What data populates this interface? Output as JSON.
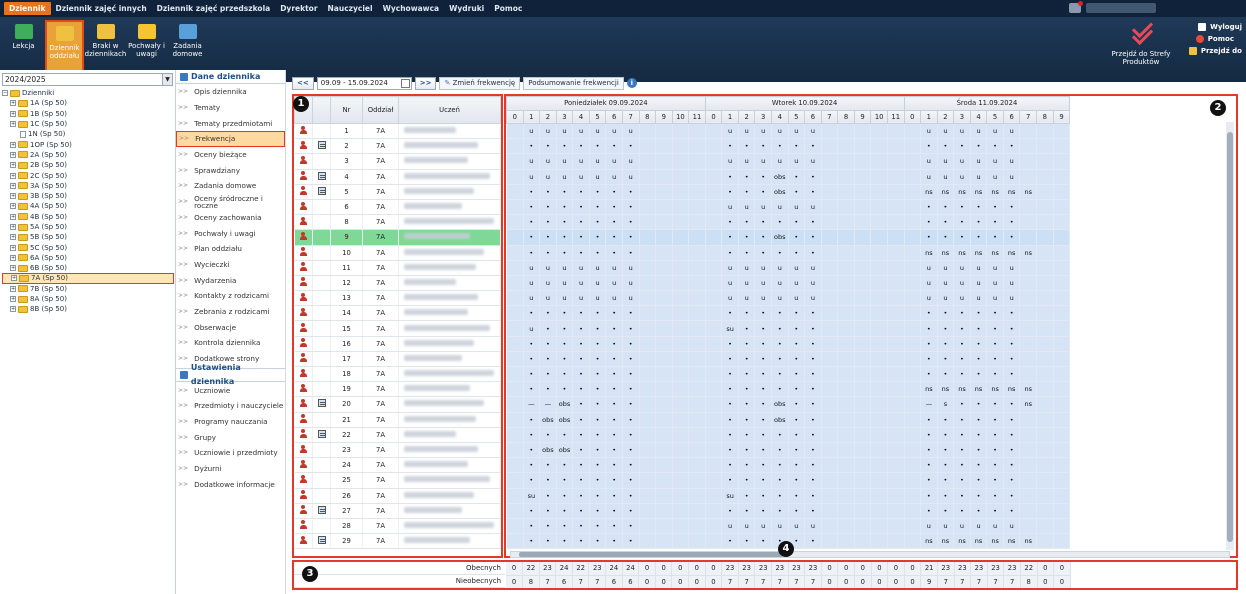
{
  "menu": [
    "Dziennik",
    "Dziennik zajęć innych",
    "Dziennik zajęć przedszkola",
    "Dyrektor",
    "Nauczyciel",
    "Wychowawca",
    "Wydruki",
    "Pomoc"
  ],
  "toolbar": [
    {
      "label": "Lekcja",
      "icon": "lesson-icon",
      "color": "#3fae5b",
      "active": false
    },
    {
      "label": "Dziennik oddziału",
      "icon": "class-journal-icon",
      "color": "#f0c040",
      "active": true
    },
    {
      "label": "Braki w dziennikach",
      "icon": "missing-entries-icon",
      "color": "#f0c040",
      "active": false
    },
    {
      "label": "Pochwały i uwagi",
      "icon": "remarks-icon",
      "color": "#f5c430",
      "active": false
    },
    {
      "label": "Zadania domowe",
      "icon": "homework-icon",
      "color": "#5aa0d8",
      "active": false
    }
  ],
  "right": {
    "strefa": "Przejdź do Strefy Produktów",
    "logout": "Wyloguj",
    "help": "Pomoc",
    "goto": "Przejdź do"
  },
  "year": "2024/2025",
  "tree": {
    "root": "Dzienniki",
    "items": [
      "1A (Sp 50)",
      "1B (Sp 50)",
      "1C (Sp 50)",
      "1N (Sp 50)",
      "1OP (Sp 50)",
      "2A (Sp 50)",
      "2B (Sp 50)",
      "2C (Sp 50)",
      "3A (Sp 50)",
      "3B (Sp 50)",
      "4A (Sp 50)",
      "4B (Sp 50)",
      "5A (Sp 50)",
      "5B (Sp 50)",
      "5C (Sp 50)",
      "6A (Sp 50)",
      "6B (Sp 50)",
      "7A (Sp 50)",
      "7B (Sp 50)",
      "8A (Sp 50)",
      "8B (Sp 50)"
    ],
    "selected": "7A (Sp 50)"
  },
  "nav": {
    "section1": "Dane dziennika",
    "items1": [
      "Opis dziennika",
      "Tematy",
      "Tematy przedmiotami",
      "Frekwencja",
      "Oceny bieżące",
      "Sprawdziany",
      "Zadania domowe",
      "Oceny śródroczne i roczne",
      "Oceny zachowania",
      "Pochwały i uwagi",
      "Plan oddziału",
      "Wycieczki",
      "Wydarzenia",
      "Kontakty z rodzicami",
      "Zebrania z rodzicami",
      "Obserwacje",
      "Kontrola dziennika",
      "Dodatkowe strony"
    ],
    "active": "Frekwencja",
    "section2": "Ustawienia dziennika",
    "items2": [
      "Uczniowie",
      "Przedmioty i nauczyciele",
      "Programy nauczania",
      "Grupy",
      "Uczniowie i przedmioty",
      "Dyżurni",
      "Dodatkowe informacje"
    ]
  },
  "controls": {
    "prev": "<<",
    "range": "09.09 - 15.09.2024",
    "next": ">>",
    "change": "Zmień frekwencję",
    "summary": "Podsumowanie frekwencji"
  },
  "table_headers": {
    "nr": "Nr",
    "class": "Oddział",
    "student": "Uczeń"
  },
  "days": [
    "Poniedziałek 09.09.2024",
    "Wtorek 10.09.2024",
    "Środa 11.09.2024"
  ],
  "lessons": [
    "0",
    "1",
    "2",
    "3",
    "4",
    "5",
    "6",
    "7",
    "8",
    "9",
    "10",
    "11"
  ],
  "students": [
    {
      "nr": "1",
      "cls": "7A",
      "note": false,
      "a": [
        "",
        "u",
        "u",
        "u",
        "u",
        "u",
        "u",
        "u",
        "",
        "",
        "",
        "",
        "",
        "u",
        "u",
        "u",
        "u",
        "u",
        "u",
        "",
        "",
        "",
        "",
        "",
        "",
        "u",
        "u",
        "u",
        "u",
        "u",
        "u",
        "",
        "",
        ""
      ]
    },
    {
      "nr": "2",
      "cls": "7A",
      "note": true,
      "a": [
        "",
        "•",
        "•",
        "•",
        "•",
        "•",
        "•",
        "•",
        "",
        "",
        "",
        "",
        "",
        "•",
        "•",
        "•",
        "•",
        "•",
        "•",
        "",
        "",
        "",
        "",
        "",
        "",
        "•",
        "•",
        "•",
        "•",
        "•",
        "•",
        "",
        "",
        ""
      ]
    },
    {
      "nr": "3",
      "cls": "7A",
      "note": false,
      "a": [
        "",
        "u",
        "u",
        "u",
        "u",
        "u",
        "u",
        "u",
        "",
        "",
        "",
        "",
        "",
        "u",
        "u",
        "u",
        "u",
        "u",
        "u",
        "",
        "",
        "",
        "",
        "",
        "",
        "u",
        "u",
        "u",
        "u",
        "u",
        "u",
        "",
        "",
        ""
      ]
    },
    {
      "nr": "4",
      "cls": "7A",
      "note": true,
      "a": [
        "",
        "u",
        "u",
        "u",
        "u",
        "u",
        "u",
        "u",
        "",
        "",
        "",
        "",
        "",
        "•",
        "•",
        "•",
        "obs",
        "•",
        "•",
        "",
        "",
        "",
        "",
        "",
        "",
        "u",
        "u",
        "u",
        "u",
        "u",
        "u",
        "",
        "",
        ""
      ]
    },
    {
      "nr": "5",
      "cls": "7A",
      "note": true,
      "a": [
        "",
        "•",
        "•",
        "•",
        "•",
        "•",
        "•",
        "•",
        "",
        "",
        "",
        "",
        "",
        "•",
        "•",
        "•",
        "obs",
        "•",
        "•",
        "",
        "",
        "",
        "",
        "",
        "",
        "ns",
        "ns",
        "ns",
        "ns",
        "ns",
        "ns",
        "ns",
        "",
        ""
      ]
    },
    {
      "nr": "6",
      "cls": "7A",
      "note": false,
      "a": [
        "",
        "•",
        "•",
        "•",
        "•",
        "•",
        "•",
        "•",
        "",
        "",
        "",
        "",
        "",
        "u",
        "u",
        "u",
        "u",
        "u",
        "u",
        "",
        "",
        "",
        "",
        "",
        "",
        "•",
        "•",
        "•",
        "•",
        "•",
        "•",
        "",
        "",
        ""
      ]
    },
    {
      "nr": "8",
      "cls": "7A",
      "note": false,
      "a": [
        "",
        "•",
        "•",
        "•",
        "•",
        "•",
        "•",
        "•",
        "",
        "",
        "",
        "",
        "",
        "•",
        "•",
        "•",
        "•",
        "•",
        "•",
        "",
        "",
        "",
        "",
        "",
        "",
        "•",
        "•",
        "•",
        "•",
        "•",
        "•",
        "",
        "",
        ""
      ]
    },
    {
      "nr": "9",
      "cls": "7A",
      "note": false,
      "hl": true,
      "a": [
        "",
        "•",
        "•",
        "•",
        "•",
        "•",
        "•",
        "•",
        "",
        "",
        "",
        "",
        "",
        "•",
        "•",
        "•",
        "obs",
        "•",
        "•",
        "",
        "",
        "",
        "",
        "",
        "",
        "•",
        "•",
        "•",
        "•",
        "•",
        "•",
        "",
        "",
        ""
      ]
    },
    {
      "nr": "10",
      "cls": "7A",
      "note": false,
      "a": [
        "",
        "•",
        "•",
        "•",
        "•",
        "•",
        "•",
        "•",
        "",
        "",
        "",
        "",
        "",
        "•",
        "•",
        "•",
        "•",
        "•",
        "•",
        "",
        "",
        "",
        "",
        "",
        "",
        "ns",
        "ns",
        "ns",
        "ns",
        "ns",
        "ns",
        "ns",
        "",
        ""
      ]
    },
    {
      "nr": "11",
      "cls": "7A",
      "note": false,
      "a": [
        "",
        "u",
        "u",
        "u",
        "u",
        "u",
        "u",
        "u",
        "",
        "",
        "",
        "",
        "",
        "u",
        "u",
        "u",
        "u",
        "u",
        "u",
        "",
        "",
        "",
        "",
        "",
        "",
        "u",
        "u",
        "u",
        "u",
        "u",
        "u",
        "",
        "",
        ""
      ]
    },
    {
      "nr": "12",
      "cls": "7A",
      "note": false,
      "a": [
        "",
        "u",
        "u",
        "u",
        "u",
        "u",
        "u",
        "u",
        "",
        "",
        "",
        "",
        "",
        "u",
        "u",
        "u",
        "u",
        "u",
        "u",
        "",
        "",
        "",
        "",
        "",
        "",
        "u",
        "u",
        "u",
        "u",
        "u",
        "u",
        "",
        "",
        ""
      ]
    },
    {
      "nr": "13",
      "cls": "7A",
      "note": false,
      "a": [
        "",
        "u",
        "u",
        "u",
        "u",
        "u",
        "u",
        "u",
        "",
        "",
        "",
        "",
        "",
        "u",
        "u",
        "u",
        "u",
        "u",
        "u",
        "",
        "",
        "",
        "",
        "",
        "",
        "u",
        "u",
        "u",
        "u",
        "u",
        "u",
        "",
        "",
        ""
      ]
    },
    {
      "nr": "14",
      "cls": "7A",
      "note": false,
      "a": [
        "",
        "•",
        "•",
        "•",
        "•",
        "•",
        "•",
        "•",
        "",
        "",
        "",
        "",
        "",
        "•",
        "•",
        "•",
        "•",
        "•",
        "•",
        "",
        "",
        "",
        "",
        "",
        "",
        "•",
        "•",
        "•",
        "•",
        "•",
        "•",
        "",
        "",
        ""
      ]
    },
    {
      "nr": "15",
      "cls": "7A",
      "note": false,
      "a": [
        "",
        "u",
        "•",
        "•",
        "•",
        "•",
        "•",
        "•",
        "",
        "",
        "",
        "",
        "",
        "su",
        "•",
        "•",
        "•",
        "•",
        "•",
        "",
        "",
        "",
        "",
        "",
        "",
        "•",
        "•",
        "•",
        "•",
        "•",
        "•",
        "",
        "",
        ""
      ]
    },
    {
      "nr": "16",
      "cls": "7A",
      "note": false,
      "a": [
        "",
        "•",
        "•",
        "•",
        "•",
        "•",
        "•",
        "•",
        "",
        "",
        "",
        "",
        "",
        "•",
        "•",
        "•",
        "•",
        "•",
        "•",
        "",
        "",
        "",
        "",
        "",
        "",
        "•",
        "•",
        "•",
        "•",
        "•",
        "•",
        "",
        "",
        ""
      ]
    },
    {
      "nr": "17",
      "cls": "7A",
      "note": false,
      "a": [
        "",
        "•",
        "•",
        "•",
        "•",
        "•",
        "•",
        "•",
        "",
        "",
        "",
        "",
        "",
        "•",
        "•",
        "•",
        "•",
        "•",
        "•",
        "",
        "",
        "",
        "",
        "",
        "",
        "•",
        "•",
        "•",
        "•",
        "•",
        "•",
        "",
        "",
        ""
      ]
    },
    {
      "nr": "18",
      "cls": "7A",
      "note": false,
      "a": [
        "",
        "•",
        "•",
        "•",
        "•",
        "•",
        "•",
        "•",
        "",
        "",
        "",
        "",
        "",
        "•",
        "•",
        "•",
        "•",
        "•",
        "•",
        "",
        "",
        "",
        "",
        "",
        "",
        "•",
        "•",
        "•",
        "•",
        "•",
        "•",
        "",
        "",
        ""
      ]
    },
    {
      "nr": "19",
      "cls": "7A",
      "note": false,
      "a": [
        "",
        "•",
        "•",
        "•",
        "•",
        "•",
        "•",
        "•",
        "",
        "",
        "",
        "",
        "",
        "•",
        "•",
        "•",
        "•",
        "•",
        "•",
        "",
        "",
        "",
        "",
        "",
        "",
        "ns",
        "ns",
        "ns",
        "ns",
        "ns",
        "ns",
        "ns",
        "",
        ""
      ]
    },
    {
      "nr": "20",
      "cls": "7A",
      "note": true,
      "a": [
        "",
        "—",
        "—",
        "obs",
        "•",
        "•",
        "•",
        "•",
        "",
        "",
        "",
        "",
        "",
        "•",
        "•",
        "•",
        "obs",
        "•",
        "•",
        "",
        "",
        "",
        "",
        "",
        "",
        "—",
        "s",
        "•",
        "•",
        "•",
        "•",
        "ns",
        "",
        ""
      ]
    },
    {
      "nr": "21",
      "cls": "7A",
      "note": false,
      "a": [
        "",
        "•",
        "obs",
        "obs",
        "•",
        "•",
        "•",
        "•",
        "",
        "",
        "",
        "",
        "",
        "•",
        "•",
        "•",
        "obs",
        "•",
        "•",
        "",
        "",
        "",
        "",
        "",
        "",
        "•",
        "•",
        "•",
        "•",
        "•",
        "•",
        "",
        "",
        ""
      ]
    },
    {
      "nr": "22",
      "cls": "7A",
      "note": true,
      "a": [
        "",
        "•",
        "•",
        "•",
        "•",
        "•",
        "•",
        "•",
        "",
        "",
        "",
        "",
        "",
        "•",
        "•",
        "•",
        "•",
        "•",
        "•",
        "",
        "",
        "",
        "",
        "",
        "",
        "•",
        "•",
        "•",
        "•",
        "•",
        "•",
        "",
        "",
        ""
      ]
    },
    {
      "nr": "23",
      "cls": "7A",
      "note": false,
      "a": [
        "",
        "•",
        "obs",
        "obs",
        "•",
        "•",
        "•",
        "•",
        "",
        "",
        "",
        "",
        "",
        "•",
        "•",
        "•",
        "•",
        "•",
        "•",
        "",
        "",
        "",
        "",
        "",
        "",
        "•",
        "•",
        "•",
        "•",
        "•",
        "•",
        "",
        "",
        ""
      ]
    },
    {
      "nr": "24",
      "cls": "7A",
      "note": false,
      "a": [
        "",
        "•",
        "•",
        "•",
        "•",
        "•",
        "•",
        "•",
        "",
        "",
        "",
        "",
        "",
        "•",
        "•",
        "•",
        "•",
        "•",
        "•",
        "",
        "",
        "",
        "",
        "",
        "",
        "•",
        "•",
        "•",
        "•",
        "•",
        "•",
        "",
        "",
        ""
      ]
    },
    {
      "nr": "25",
      "cls": "7A",
      "note": false,
      "a": [
        "",
        "•",
        "•",
        "•",
        "•",
        "•",
        "•",
        "•",
        "",
        "",
        "",
        "",
        "",
        "•",
        "•",
        "•",
        "•",
        "•",
        "•",
        "",
        "",
        "",
        "",
        "",
        "",
        "•",
        "•",
        "•",
        "•",
        "•",
        "•",
        "",
        "",
        ""
      ]
    },
    {
      "nr": "26",
      "cls": "7A",
      "note": false,
      "a": [
        "",
        "su",
        "•",
        "•",
        "•",
        "•",
        "•",
        "•",
        "",
        "",
        "",
        "",
        "",
        "su",
        "•",
        "•",
        "•",
        "•",
        "•",
        "",
        "",
        "",
        "",
        "",
        "",
        "•",
        "•",
        "•",
        "•",
        "•",
        "•",
        "",
        "",
        ""
      ]
    },
    {
      "nr": "27",
      "cls": "7A",
      "note": true,
      "a": [
        "",
        "•",
        "•",
        "•",
        "•",
        "•",
        "•",
        "•",
        "",
        "",
        "",
        "",
        "",
        "•",
        "•",
        "•",
        "•",
        "•",
        "•",
        "",
        "",
        "",
        "",
        "",
        "",
        "•",
        "•",
        "•",
        "•",
        "•",
        "•",
        "",
        "",
        ""
      ]
    },
    {
      "nr": "28",
      "cls": "7A",
      "note": false,
      "a": [
        "",
        "•",
        "•",
        "•",
        "•",
        "•",
        "•",
        "•",
        "",
        "",
        "",
        "",
        "",
        "u",
        "u",
        "u",
        "u",
        "u",
        "u",
        "",
        "",
        "",
        "",
        "",
        "",
        "u",
        "u",
        "u",
        "u",
        "u",
        "u",
        "",
        "",
        ""
      ]
    },
    {
      "nr": "29",
      "cls": "7A",
      "note": true,
      "a": [
        "",
        "•",
        "•",
        "•",
        "•",
        "•",
        "•",
        "•",
        "",
        "",
        "",
        "",
        "",
        "•",
        "•",
        "•",
        "•",
        "•",
        "•",
        "",
        "",
        "",
        "",
        "",
        "",
        "ns",
        "ns",
        "ns",
        "ns",
        "ns",
        "ns",
        "ns",
        "",
        ""
      ]
    }
  ],
  "totals": {
    "present_label": "Obecnych",
    "absent_label": "Nieobecnych",
    "present": [
      "0",
      "22",
      "23",
      "24",
      "22",
      "23",
      "24",
      "24",
      "0",
      "0",
      "0",
      "0",
      "0",
      "23",
      "23",
      "23",
      "23",
      "23",
      "23",
      "0",
      "0",
      "0",
      "0",
      "0",
      "0",
      "21",
      "23",
      "23",
      "23",
      "23",
      "23",
      "22",
      "0",
      "0"
    ],
    "absent": [
      "0",
      "8",
      "7",
      "6",
      "7",
      "7",
      "6",
      "6",
      "0",
      "0",
      "0",
      "0",
      "0",
      "7",
      "7",
      "7",
      "7",
      "7",
      "7",
      "0",
      "0",
      "0",
      "0",
      "0",
      "0",
      "9",
      "7",
      "7",
      "7",
      "7",
      "7",
      "8",
      "0",
      "0"
    ]
  },
  "badges": [
    "1",
    "2",
    "3",
    "4"
  ]
}
